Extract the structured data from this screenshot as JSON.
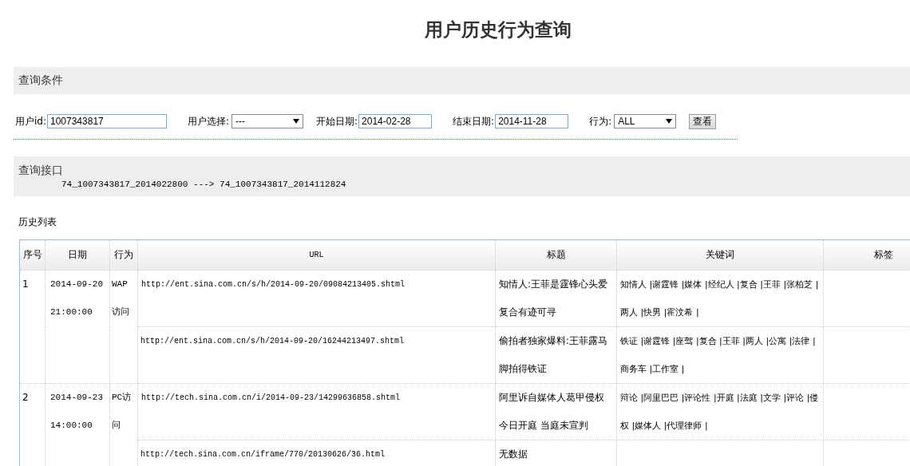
{
  "page_title": "用户历史行为查询",
  "query_section": {
    "heading": "查询条件",
    "user_id": {
      "label": "用户id:",
      "value": "1007343817"
    },
    "user_select": {
      "label": "用户选择:",
      "value": "---"
    },
    "start_date": {
      "label": "开始日期:",
      "value": "2014-02-28"
    },
    "end_date": {
      "label": "结束日期:",
      "value": "2014-11-28"
    },
    "action": {
      "label": "行为:",
      "value": "ALL"
    },
    "submit_button": "查看"
  },
  "interface_section": {
    "heading": "查询接口",
    "text": "74_1007343817_2014022800 ---> 74_1007343817_2014112824"
  },
  "history": {
    "heading": "历史列表",
    "columns": [
      "序号",
      "日期",
      "行为",
      "URL",
      "标题",
      "关键词",
      "标签"
    ],
    "records": [
      {
        "no": "1",
        "date": "2014-09-20 21:00:00",
        "action": "WAP访问",
        "items": [
          {
            "url": "http://ent.sina.com.cn/s/h/2014-09-20/09084213405.shtml",
            "title": "知情人:王菲是霆锋心头爱复合有迹可寻",
            "keywords": "知情人 |谢霆锋 |媒体 |经纪人 |复合 |王菲 |张柏芝 |两人 |快男 |霍汶希 |"
          },
          {
            "url": "http://ent.sina.com.cn/s/h/2014-09-20/16244213497.shtml",
            "title": "偷拍者独家爆料:王菲露马脚拍得铁证",
            "keywords": "铁证 |谢霆锋 |座驾 |复合 |王菲 |两人 |公寓 |法律 |商务车 |工作室 |"
          }
        ]
      },
      {
        "no": "2",
        "date": "2014-09-23 14:00:00",
        "action": "PC访问",
        "items": [
          {
            "url": "http://tech.sina.com.cn/i/2014-09-23/14299636858.shtml",
            "title": "阿里诉自媒体人葛甲侵权今日开庭 当庭未宣判",
            "keywords": "辩论 |阿里巴巴 |评论性 |开庭 |法庭 |文学 |评论 |侵权 |媒体人 |代理律师 |"
          },
          {
            "url": "http://tech.sina.com.cn/iframe/770/20130626/36.html",
            "title": "无数据"
          }
        ]
      }
    ]
  }
}
